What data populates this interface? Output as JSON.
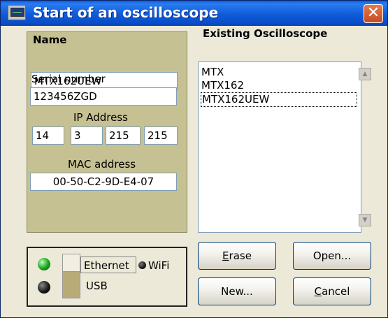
{
  "window": {
    "title": "Start of an oscilloscope",
    "close_symbol": "✕"
  },
  "form": {
    "name_label": "Name",
    "name_value": "MTX162UEW",
    "serial_label": "Serial number",
    "serial_value": "123456ZGD",
    "ip_label": "IP Address",
    "ip_parts": [
      "14",
      "3",
      "215",
      "215"
    ],
    "mac_label": "MAC address",
    "mac_value": "00-50-C2-9D-E4-07"
  },
  "existing": {
    "label": "Existing Oscilloscope",
    "items": [
      "MTX",
      "MTX162",
      "MTX162UEW"
    ],
    "selected_index": 2
  },
  "connection": {
    "ethernet_label": "Ethernet",
    "usb_label": "USB",
    "wifi_label": "WiFi",
    "ethernet_led_color": "#18a018",
    "usb_led_color": "#111111"
  },
  "buttons": {
    "erase": {
      "first": "E",
      "rest": "rase"
    },
    "open": "Open...",
    "new": "New...",
    "cancel": {
      "first": "C",
      "rest": "ancel"
    }
  }
}
